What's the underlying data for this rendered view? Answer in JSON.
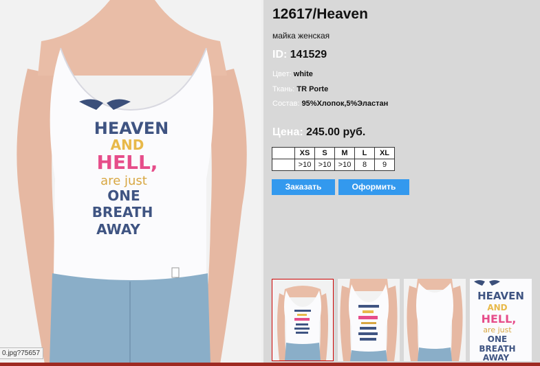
{
  "product": {
    "title": "12617/Heaven",
    "subtitle": "майка женская",
    "id_label": "ID:",
    "id_value": "141529",
    "color_label": "Цвет:",
    "color_value": "white",
    "fabric_label": "Ткань:",
    "fabric_value": "TR Porte",
    "composition_label": "Состав:",
    "composition_value": "95%Хлопок,5%Эластан",
    "price_label": "Цена:",
    "price_value": "245.00 руб."
  },
  "sizes": {
    "headers": [
      "XS",
      "S",
      "M",
      "L",
      "XL"
    ],
    "stock": [
      ">10",
      ">10",
      ">10",
      "8",
      "9"
    ]
  },
  "buttons": {
    "order": "Заказать",
    "checkout": "Оформить"
  },
  "print": {
    "line1": "HEAVEN",
    "line2": "AND",
    "line3": "HELL,",
    "line4": "are just",
    "line5": "ONE",
    "line6": "BREATH",
    "line7": "AWAY"
  },
  "status_url": "0.jpg?75657",
  "colors": {
    "accent": "#3399ee",
    "selected_border": "#cc0000",
    "footer_bar": "#9e2a22"
  }
}
